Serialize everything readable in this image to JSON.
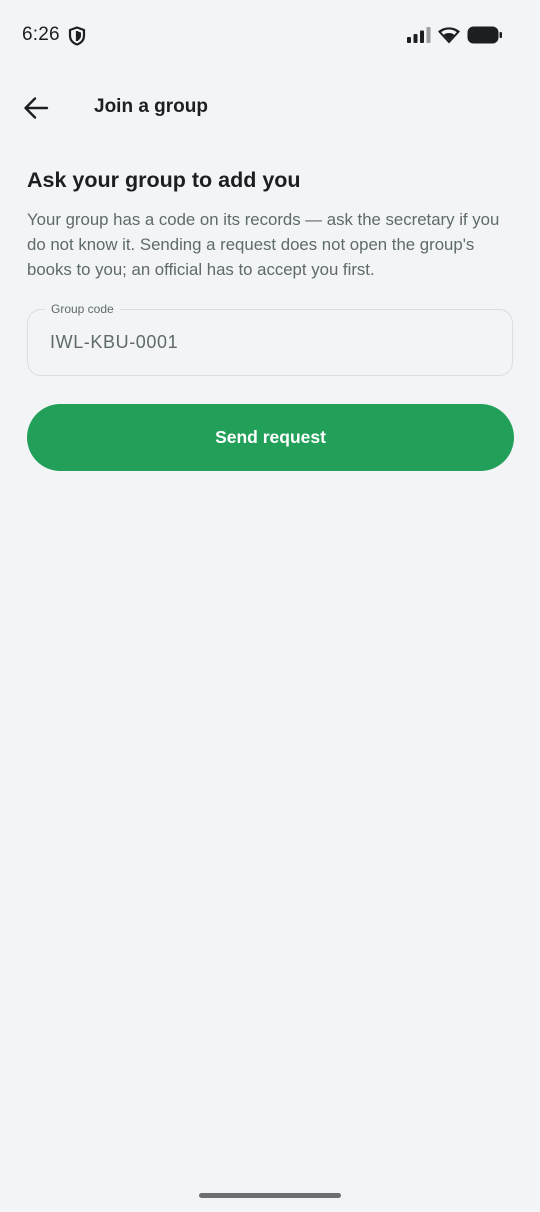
{
  "status_bar": {
    "time": "6:26",
    "icons": [
      "shield-icon",
      "signal-icon",
      "wifi-icon",
      "battery-icon"
    ]
  },
  "app_bar": {
    "back_icon": "arrow-left-icon",
    "title": "Join a group"
  },
  "content": {
    "heading": "Ask your group to add you",
    "description": "Your group has a code on its records — ask the secretary if you do not know it. Sending a request does not open the group's books to you; an official has to accept you first.",
    "group_code_field": {
      "label": "Group code",
      "value": "IWL-KBU-0001"
    },
    "send_button_label": "Send request"
  },
  "colors": {
    "background": "#f2f4f6",
    "accent": "#22a05a",
    "text_primary": "#1c1f22",
    "text_secondary": "#5f6a6a"
  }
}
